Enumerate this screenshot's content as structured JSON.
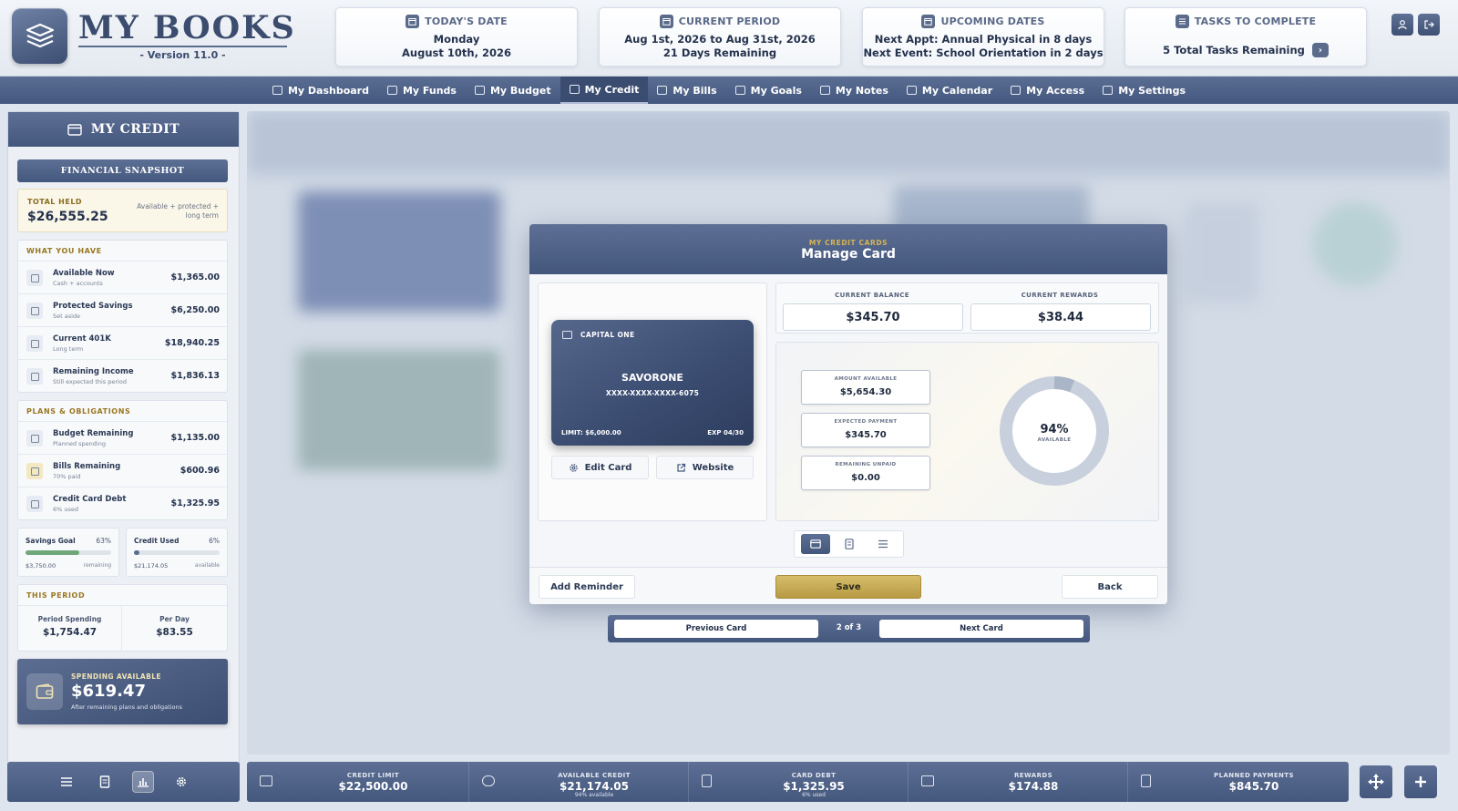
{
  "app": {
    "title": "MY BOOKS",
    "version": "- Version 11.0 -"
  },
  "header": {
    "today": {
      "label": "TODAY'S DATE",
      "line1": "Monday",
      "line2": "August 10th, 2026"
    },
    "period": {
      "label": "CURRENT PERIOD",
      "line1": "Aug 1st, 2026 to Aug 31st, 2026",
      "line2": "21 Days Remaining"
    },
    "upcoming": {
      "label": "UPCOMING DATES",
      "line1": "Next Appt: Annual Physical in 8 days",
      "line2": "Next Event: School Orientation in 2 days"
    },
    "tasks": {
      "label": "TASKS TO COMPLETE",
      "line1": "5 Total Tasks Remaining",
      "arrow": "›"
    }
  },
  "nav": {
    "items": [
      {
        "label": "My Dashboard",
        "icon": "home-icon"
      },
      {
        "label": "My Funds",
        "icon": "wallet-icon"
      },
      {
        "label": "My Budget",
        "icon": "chart-icon"
      },
      {
        "label": "My Credit",
        "icon": "card-icon",
        "active": true
      },
      {
        "label": "My Bills",
        "icon": "receipt-icon"
      },
      {
        "label": "My Goals",
        "icon": "flag-icon"
      },
      {
        "label": "My Notes",
        "icon": "note-icon"
      },
      {
        "label": "My Calendar",
        "icon": "calendar-icon"
      },
      {
        "label": "My Access",
        "icon": "key-icon"
      },
      {
        "label": "My Settings",
        "icon": "gear-icon"
      }
    ]
  },
  "sidebar": {
    "title": "MY CREDIT",
    "snapshot_label": "FINANCIAL SNAPSHOT",
    "total_held": {
      "label": "TOTAL HELD",
      "value": "$26,555.25",
      "note": "Available + protected + long term"
    },
    "have": {
      "title": "WHAT YOU HAVE",
      "rows": [
        {
          "name": "Available Now",
          "sub": "Cash + accounts",
          "value": "$1,365.00"
        },
        {
          "name": "Protected Savings",
          "sub": "Set aside",
          "value": "$6,250.00"
        },
        {
          "name": "Current 401K",
          "sub": "Long term",
          "value": "$18,940.25"
        },
        {
          "name": "Remaining Income",
          "sub": "Still expected this period",
          "value": "$1,836.13"
        }
      ]
    },
    "plans": {
      "title": "PLANS & OBLIGATIONS",
      "rows": [
        {
          "name": "Budget Remaining",
          "sub": "Planned spending",
          "value": "$1,135.00"
        },
        {
          "name": "Bills Remaining",
          "sub": "70% paid",
          "value": "$600.96"
        },
        {
          "name": "Credit Card Debt",
          "sub": "6% used",
          "value": "$1,325.95"
        }
      ]
    },
    "savings_goal": {
      "label": "Savings Goal",
      "pct": "63%",
      "progress": 0.63,
      "value": "$3,750.00",
      "sub": "remaining"
    },
    "credit_used": {
      "label": "Credit Used",
      "pct": "6%",
      "progress": 0.06,
      "value": "$21,174.05",
      "sub": "available"
    },
    "this_period": {
      "title": "THIS PERIOD",
      "spending_label": "Period Spending",
      "spending_value": "$1,754.47",
      "perday_label": "Per Day",
      "perday_value": "$83.55"
    },
    "spending_available": {
      "label": "SPENDING AVAILABLE",
      "value": "$619.47",
      "note": "After remaining plans and obligations"
    }
  },
  "modal": {
    "subtitle": "MY CREDIT CARDS",
    "title": "Manage Card",
    "card": {
      "bank": "CAPITAL ONE",
      "name": "SAVORONE",
      "number": "XXXX-XXXX-XXXX-6075",
      "limit": "LIMIT: $6,000.00",
      "exp": "EXP 04/30"
    },
    "edit_label": "Edit Card",
    "website_label": "Website",
    "balance_label": "CURRENT BALANCE",
    "balance_value": "$345.70",
    "rewards_label": "CURRENT REWARDS",
    "rewards_value": "$38.44",
    "amount_available_label": "AMOUNT AVAILABLE",
    "amount_available_value": "$5,654.30",
    "expected_payment_label": "EXPECTED PAYMENT",
    "expected_payment_value": "$345.70",
    "remaining_unpaid_label": "REMAINING UNPAID",
    "remaining_unpaid_value": "$0.00",
    "donut_pct": "94%",
    "donut_label": "AVAILABLE",
    "donut_fraction": 0.94,
    "add_reminder_label": "Add Reminder",
    "save_label": "Save",
    "back_label": "Back"
  },
  "pager": {
    "prev_label": "Previous Card",
    "count": "2 of 3",
    "next_label": "Next Card"
  },
  "statbar": {
    "credit_limit": {
      "label": "CREDIT LIMIT",
      "value": "$22,500.00",
      "sub": ""
    },
    "available_credit": {
      "label": "AVAILABLE CREDIT",
      "value": "$21,174.05",
      "sub": "94% available"
    },
    "card_debt": {
      "label": "CARD DEBT",
      "value": "$1,325.95",
      "sub": "6% used"
    },
    "rewards": {
      "label": "REWARDS",
      "value": "$174.88",
      "sub": ""
    },
    "planned_payments": {
      "label": "PLANNED PAYMENTS",
      "value": "$845.70",
      "sub": ""
    }
  },
  "colors": {
    "accent": "#44577d",
    "gold": "#c9ab57",
    "background": "#dfe5ee"
  }
}
